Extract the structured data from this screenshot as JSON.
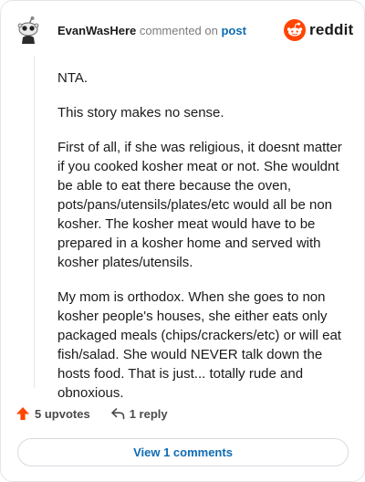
{
  "comment": {
    "author": "EvanWasHere",
    "action_text": "commented on",
    "post_link": "post",
    "paragraphs": [
      "NTA.",
      "This story makes no sense.",
      "First of all, if she was religious, it doesnt matter if you cooked kosher meat or not. She wouldnt be able to eat there because the oven, pots/pans/utensils/plates/etc would all be non kosher. The kosher meat would have to be prepared in a kosher home and served with kosher plates/utensils.",
      "My mom is orthodox. When she goes to non kosher people's houses, she either eats only packaged meals (chips/crackers/etc) or will eat fish/salad. She would NEVER talk down the hosts food. That is just... totally rude and obnoxious."
    ],
    "upvotes_label": "5 upvotes",
    "replies_label": "1 reply",
    "view_comments_label": "View 1 comments"
  },
  "brand": {
    "name": "reddit",
    "accent_color": "#ff4500",
    "upvote_color": "#ff4500",
    "link_color": "#0e6bb3"
  },
  "icons": {
    "avatar": "snoo-avatar-icon",
    "logo": "reddit-logo-icon",
    "upvote": "upvote-arrow-icon",
    "reply": "reply-arrow-icon"
  }
}
